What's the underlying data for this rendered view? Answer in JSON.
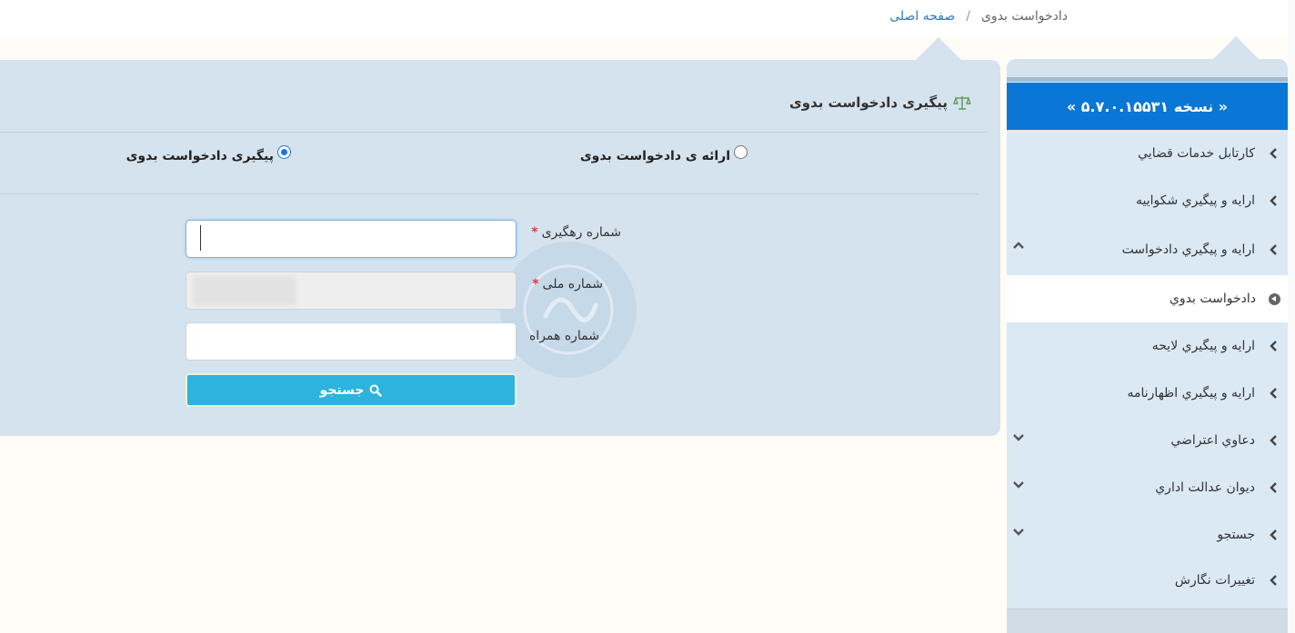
{
  "breadcrumb": {
    "home": "صفحه اصلی",
    "separator": "/",
    "current": "دادخواست بدوی"
  },
  "panel": {
    "title": "پیگیری دادخواست بدوی",
    "title_icon": "scale-icon"
  },
  "radio_options": [
    {
      "label": "ارائه ی دادخواست بدوی",
      "selected": false
    },
    {
      "label": "پیگیری دادخواست بدوی",
      "selected": true
    }
  ],
  "form": {
    "tracking_number": {
      "label": "شماره رهگیری",
      "required": "*",
      "value": ""
    },
    "national_code": {
      "label": "شماره ملی",
      "required": "*",
      "value": ""
    },
    "mobile": {
      "label": "شماره همراه",
      "value": ""
    },
    "search_button": "جستجو",
    "search_icon": "search-icon"
  },
  "sidebar": {
    "version": "« نسخه ۵.۷.۰.۱۵۵۳۱ »",
    "items": [
      {
        "label": "کارتابل خدمات قضايي",
        "expand": ""
      },
      {
        "label": "ارايه و پيگيري شکواييه",
        "expand": ""
      },
      {
        "label": "ارايه و پيگيري دادخواست",
        "expand": "up"
      },
      {
        "label": "دادخواست بدوي",
        "expand": "",
        "active": true
      },
      {
        "label": "ارايه و پيگيري لايحه",
        "expand": ""
      },
      {
        "label": "ارايه و پيگيري اظهارنامه",
        "expand": ""
      },
      {
        "label": "دعاوي اعتراضي",
        "expand": "down"
      },
      {
        "label": "ديوان عدالت اداري",
        "expand": "down"
      },
      {
        "label": "جستجو",
        "expand": "down"
      },
      {
        "label": "تغييرات نگارش",
        "expand": ""
      }
    ]
  },
  "colors": {
    "accent": "#0a76d6",
    "panel_bg": "#d5e3ee",
    "button": "#2db3dd",
    "required": "#e53935"
  }
}
